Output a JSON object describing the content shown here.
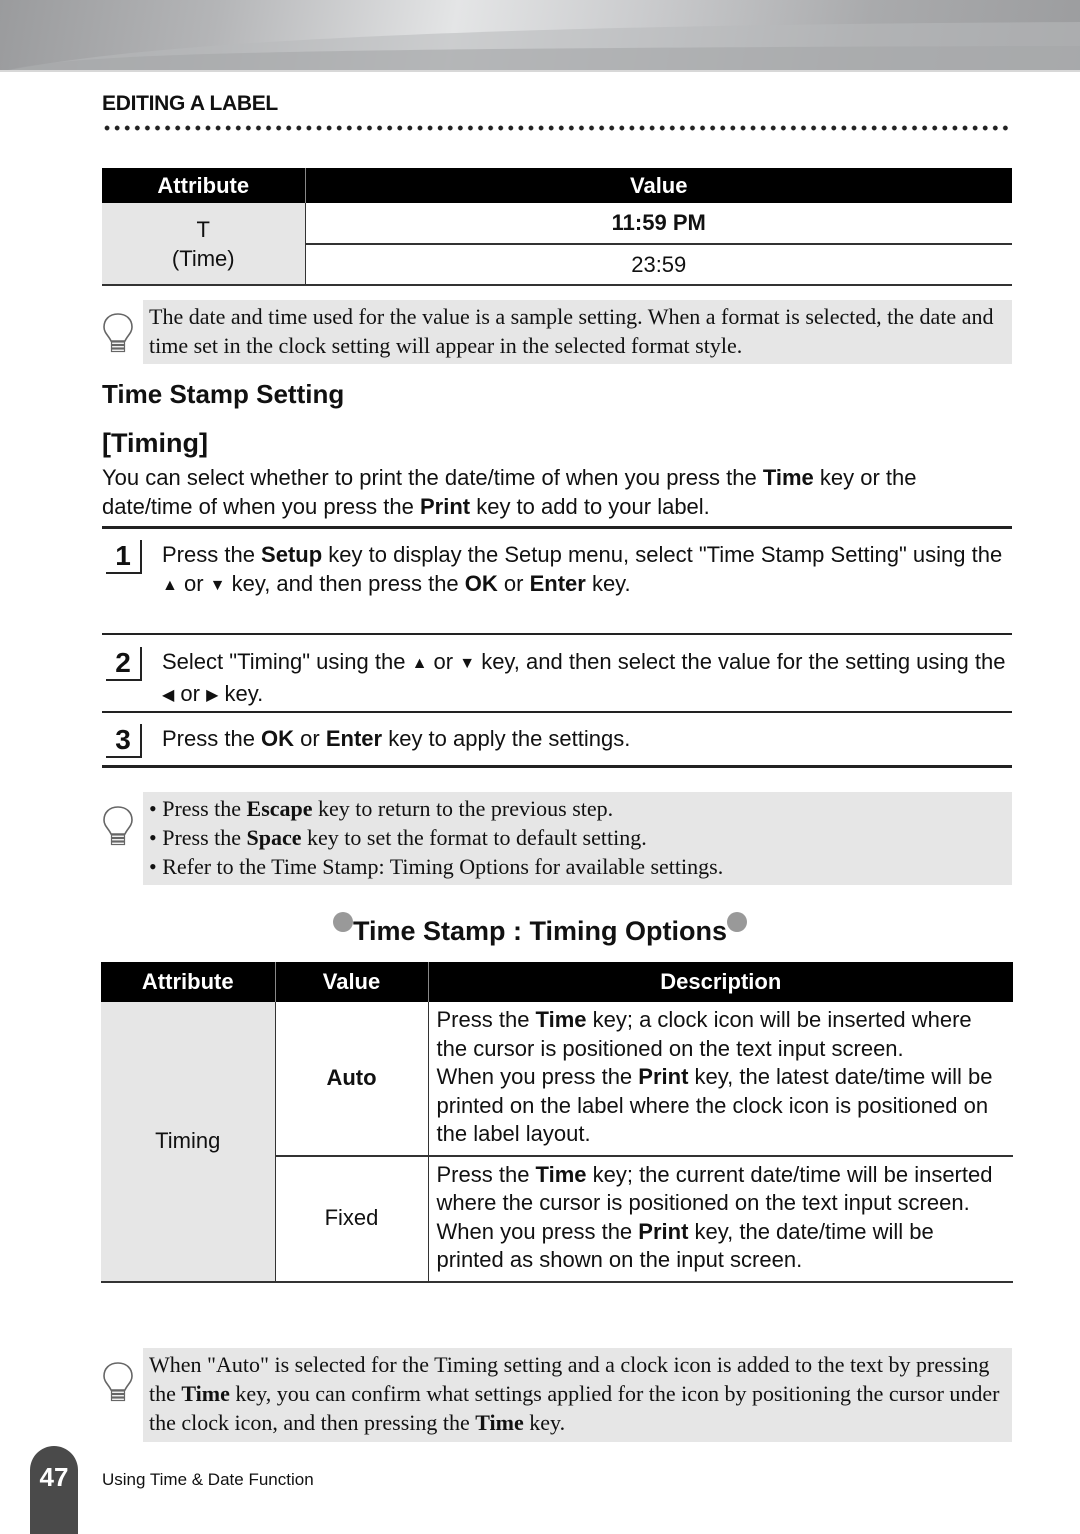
{
  "header": {
    "section_title": "EDITING A LABEL"
  },
  "table1": {
    "headers": [
      "Attribute",
      "Value"
    ],
    "attribute_lines": [
      "T",
      "(Time)"
    ],
    "values": [
      "11:59 PM",
      "23:59"
    ]
  },
  "note1": {
    "text": "The date and time used for the value is a sample setting. When a format is selected, the date and time set in the clock setting will appear in the selected format style."
  },
  "headings": {
    "time_stamp_setting": "Time Stamp Setting",
    "timing": "[Timing]"
  },
  "intro": {
    "part1": "You can select whether to print the date/time of when you press the ",
    "bold1": "Time",
    "part2": " key or the date/time of when you press the ",
    "bold2": "Print",
    "part3": " key to add to your label."
  },
  "steps": [
    {
      "number": "1",
      "p1": "Press the ",
      "b1": "Setup",
      "p2": " key to display the Setup menu, select \"Time Stamp Setting\" using the ",
      "up": "▲",
      "or1": " or ",
      "down": "▼",
      "p3": " key, and then press the ",
      "b2": "OK",
      "or2": " or ",
      "b3": "Enter",
      "p4": " key."
    },
    {
      "number": "2",
      "p1": "Select \"Timing\" using the ",
      "up": "▲",
      "or1": " or ",
      "down": "▼",
      "p2": " key, and then select the value for the setting using the ",
      "left": "◀",
      "or2": " or ",
      "right": "▶",
      "p3": " key."
    },
    {
      "number": "3",
      "p1": "Press the ",
      "b1": "OK",
      "or1": " or ",
      "b2": "Enter",
      "p2": " key to apply the settings."
    }
  ],
  "note2": {
    "bullets": [
      {
        "pre": "Press the ",
        "bold": "Escape",
        "post": " key to return to the previous step."
      },
      {
        "pre": "Press the ",
        "bold": "Space",
        "post": " key to set the format to default setting."
      },
      {
        "pre": "Refer to the Time Stamp: Timing Options for available settings.",
        "bold": "",
        "post": ""
      }
    ]
  },
  "options": {
    "title": "Time Stamp : Timing Options",
    "headers": [
      "Attribute",
      "Value",
      "Description"
    ],
    "attribute": "Timing",
    "rows": [
      {
        "value": "Auto",
        "d1": "Press the ",
        "d1b": "Time",
        "d2": " key; a clock icon will be inserted where the cursor is positioned on the text input screen.",
        "d3": "When you press the ",
        "d3b": "Print",
        "d4": " key, the latest date/time will be printed on the label where the clock icon is positioned on the label layout."
      },
      {
        "value": "Fixed",
        "d1": "Press the ",
        "d1b": "Time",
        "d2": " key; the current date/time will be inserted where the cursor is positioned on the text input screen.",
        "d3": "When you press the ",
        "d3b": "Print",
        "d4": " key, the date/time will be printed as shown on the input screen."
      }
    ]
  },
  "note3": {
    "p1": "When \"Auto\" is selected for the Timing setting and a clock icon is added to the text by pressing the ",
    "b1": "Time",
    "p2": " key, you can confirm what settings applied for the icon by positioning the cursor under the clock icon, and then pressing the ",
    "b2": "Time",
    "p3": " key."
  },
  "footer": {
    "page_number": "47",
    "chapter": "Using Time & Date Function"
  }
}
